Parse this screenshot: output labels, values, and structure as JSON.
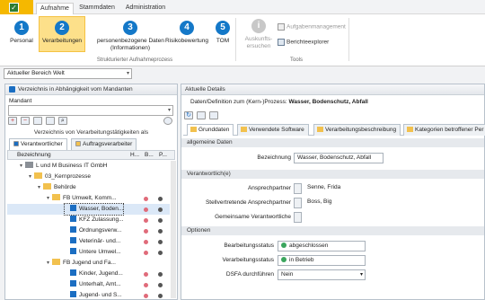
{
  "ribbon_tabs": [
    "Aufnahme",
    "Stammdaten",
    "Administration"
  ],
  "steps": [
    {
      "num": "1",
      "label": "Personal"
    },
    {
      "num": "2",
      "label": "Verarbeitungen"
    },
    {
      "num": "3",
      "label": "personenbezogene Daten",
      "label2": "(Informationen)"
    },
    {
      "num": "4",
      "label": "Risikobewertung"
    },
    {
      "num": "5",
      "label": "TOM"
    }
  ],
  "group_process": "Strukturierter Aufnahmeprozess",
  "tools": {
    "auskunft1": "Auskunfts-",
    "auskunft2": "ersuchen",
    "aufgaben": "Aufgabenmanagement",
    "bericht": "Berichteexplorer",
    "group": "Tools"
  },
  "scope": {
    "label": "Aktueller Bereich",
    "value": "Welt"
  },
  "left": {
    "title": "Verzeichnis in Abhängigkeit vom Mandanten",
    "mandant_label": "Mandant",
    "sub_title": "Verzeichnis von Verarbeitungstätigkeiten als",
    "tabs": [
      "Verantwortlicher",
      "Auftragsverarbeiter"
    ],
    "columns": [
      "Bezeichnung",
      "H...",
      "B...",
      "P..."
    ],
    "rows": [
      {
        "text": "L und M Business IT GmbH",
        "icon": "org",
        "exp": "▾",
        "indent": 14,
        "dots": []
      },
      {
        "text": "03_Kernprozesse",
        "icon": "fold",
        "exp": "▾",
        "indent": 24,
        "dots": []
      },
      {
        "text": "Behörde",
        "icon": "fold",
        "exp": "▾",
        "indent": 34,
        "dots": []
      },
      {
        "text": "FB Umwelt, Komm...",
        "icon": "fold",
        "exp": "▾",
        "indent": 44,
        "dots": [
          "#e06b7a",
          "#555"
        ]
      },
      {
        "text": "Wasser, Boden...",
        "icon": "doc",
        "exp": "",
        "indent": 64,
        "dots": [
          "#e06b7a",
          "#555"
        ],
        "selected": true
      },
      {
        "text": "KFZ Zulassung...",
        "icon": "doc",
        "exp": "",
        "indent": 64,
        "dots": [
          "#e06b7a",
          "#555"
        ]
      },
      {
        "text": "Ordnungsverw...",
        "icon": "doc",
        "exp": "",
        "indent": 64,
        "dots": [
          "#e06b7a",
          "#555"
        ]
      },
      {
        "text": "Veterinär- und...",
        "icon": "doc",
        "exp": "",
        "indent": 64,
        "dots": [
          "#e06b7a",
          "#555"
        ]
      },
      {
        "text": "Untere Umwel...",
        "icon": "doc",
        "exp": "",
        "indent": 64,
        "dots": [
          "#e06b7a",
          "#555"
        ]
      },
      {
        "text": "FB Jugend und Fa...",
        "icon": "fold",
        "exp": "▾",
        "indent": 44,
        "dots": []
      },
      {
        "text": "Kinder, Jugend...",
        "icon": "doc",
        "exp": "",
        "indent": 64,
        "dots": [
          "#e06b7a",
          "#555"
        ]
      },
      {
        "text": "Unterhalt, Amt...",
        "icon": "doc",
        "exp": "",
        "indent": 64,
        "dots": [
          "#e06b7a",
          "#555"
        ]
      },
      {
        "text": "Jugend- und S...",
        "icon": "doc",
        "exp": "",
        "indent": 64,
        "dots": [
          "#e06b7a",
          "#555"
        ]
      }
    ]
  },
  "right": {
    "title": "Aktuelle Details",
    "process_label": "Daten/Definition zum (Kern-)Prozess:",
    "process_value": "Wasser, Bodenschutz, Abfall",
    "tabs": [
      "Grunddaten",
      "Verwendete Software",
      "Verarbeitungsbeschreibung",
      "Kategorien betroffener Per"
    ],
    "sec_general": "allgemeine Daten",
    "bezeichnung_label": "Bezeichnung",
    "bezeichnung_value": "Wasser, Bodenschutz, Abfall",
    "sec_resp": "Verantwortlich(e)",
    "ansprech_label": "Ansprechpartner",
    "ansprech_value": "Senne, Frida",
    "stellv_label": "Stellvertretende Ansprechpartner",
    "stellv_value": "Boss, Big",
    "gemeinsam_label": "Gemeinsame Verantwortliche",
    "sec_options": "Optionen",
    "bearb_label": "Bearbeitungsstatus",
    "bearb_value": "abgeschlossen",
    "verarb_label": "Verarbeitungsstatus",
    "verarb_value": "in Betrieb",
    "dsfa_label": "DSFA durchführen",
    "dsfa_value": "Nein"
  },
  "colors": {
    "accent": "#1478c8",
    "app": "#f5b800",
    "highlight": "#fde08a"
  }
}
